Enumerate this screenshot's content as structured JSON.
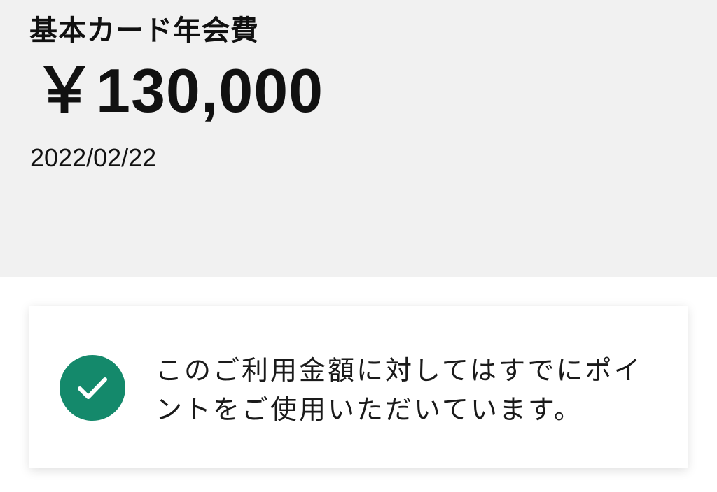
{
  "fee": {
    "title": "基本カード年会費",
    "amount": "￥130,000",
    "date": "2022/02/22"
  },
  "notice": {
    "icon": "check-circle-icon",
    "icon_color": "#14896b",
    "message_line1": "このご利用金額に対してはすでにポイ",
    "message_line2": "ントをご使用いただいています。"
  }
}
